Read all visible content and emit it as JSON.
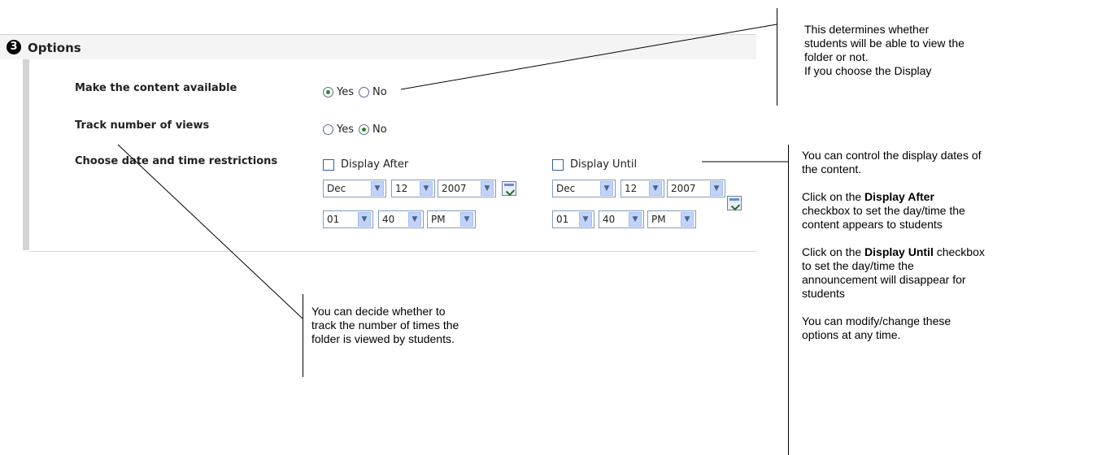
{
  "options": {
    "step_number": "3",
    "title": "Options",
    "rows": {
      "available": {
        "label": "Make the content available",
        "yes": "Yes",
        "no": "No",
        "selected": "Yes"
      },
      "track": {
        "label": "Track number of views",
        "yes": "Yes",
        "no": "No",
        "selected": "No"
      },
      "restrictions": {
        "label": "Choose date and time restrictions"
      }
    },
    "display_after": {
      "label": "Display After",
      "month": "Dec",
      "day": "12",
      "year": "2007",
      "hour": "01",
      "minute": "40",
      "ampm": "PM"
    },
    "display_until": {
      "label": "Display Until",
      "month": "Dec",
      "day": "12",
      "year": "2007",
      "hour": "01",
      "minute": "40",
      "ampm": "PM"
    }
  },
  "callouts": {
    "availability": {
      "line1": "This determines whether",
      "line2": "students will be able to view the",
      "line3": "folder or not.",
      "line4": "If you choose the Display"
    },
    "tracking": {
      "line1": "You can decide whether to",
      "line2": "track the number of times the",
      "line3": "folder is viewed by students."
    },
    "dates": {
      "p1_line1": "You can control the display dates of",
      "p1_line2": "the content.",
      "p2_pre": "Click on the ",
      "p2_bold": "Display After",
      "p2_line2": "checkbox to set the day/time the",
      "p2_line3": "content appears to students",
      "p3_pre": "Click on the ",
      "p3_bold": "Display Until",
      "p3_post": " checkbox",
      "p3_line2": "to set the day/time the",
      "p3_line3": "announcement will disappear for",
      "p3_line4": "students",
      "p4_line1": "You can modify/change these",
      "p4_line2": "options at any time."
    }
  },
  "icons": {
    "step": "step-number-icon",
    "dropdown": "chevron-down-icon",
    "calendar": "calendar-icon"
  }
}
